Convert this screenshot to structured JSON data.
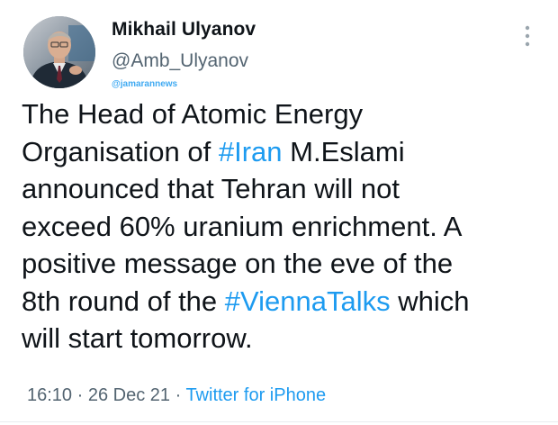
{
  "author": {
    "display_name": "Mikhail Ulyanov",
    "handle": "@Amb_Ulyanov",
    "avatar_icon": "profile-photo"
  },
  "watermark": "@jamarannews",
  "menu_icon": "more-vertical-icon",
  "tweet": {
    "seg1": "The Head of Atomic Energy\nOrganisation of ",
    "hashtag1": "#Iran",
    "seg2": " M.Eslami\nannounced that Tehran will not\nexceed 60% uranium enrichment. A\npositive message on the eve of the\n8th round of the ",
    "hashtag2": "#ViennaTalks",
    "seg3": " which\nwill start tomorrow."
  },
  "meta": {
    "time": "16:10",
    "sep1": " · ",
    "date": "26 Dec 21",
    "sep2": " · ",
    "source": "Twitter for iPhone"
  },
  "colors": {
    "link": "#1d9bf0",
    "secondary_text": "#536471",
    "primary_text": "#0f1419"
  }
}
